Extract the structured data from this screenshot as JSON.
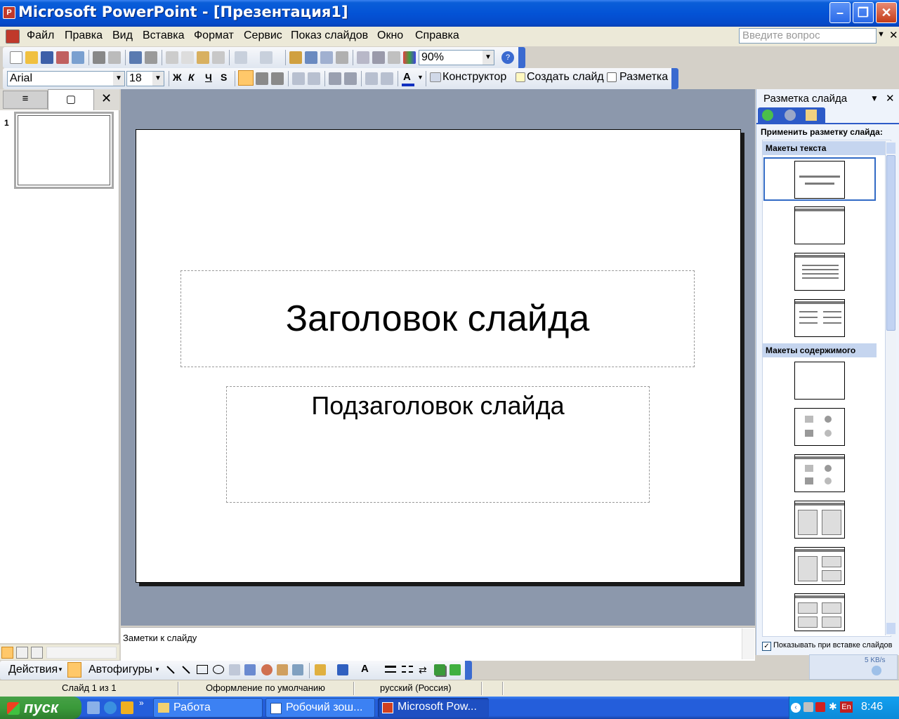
{
  "window": {
    "title": "Microsoft PowerPoint - [Презентация1]"
  },
  "menu": {
    "items": [
      "Файл",
      "Правка",
      "Вид",
      "Вставка",
      "Формат",
      "Сервис",
      "Показ слайдов",
      "Окно",
      "Справка"
    ],
    "ask_placeholder": "Введите вопрос"
  },
  "standard_toolbar": {
    "zoom": "90%"
  },
  "formatting_toolbar": {
    "font": "Arial",
    "size": "18",
    "bold": "Ж",
    "italic": "К",
    "underline": "Ч",
    "shadow": "S",
    "designer": "Конструктор",
    "new_slide": "Создать слайд",
    "layout": "Разметка"
  },
  "slides_pane": {
    "slide_number": "1"
  },
  "slide": {
    "title": "Заголовок слайда",
    "subtitle": "Подзаголовок слайда"
  },
  "notes": {
    "placeholder": "Заметки к слайду"
  },
  "task_pane": {
    "title": "Разметка слайда",
    "apply_label": "Применить разметку слайда:",
    "section_text": "Макеты текста",
    "section_content": "Макеты содержимого",
    "show_on_insert": "Показывать при вставке слайдов"
  },
  "drawing_toolbar": {
    "actions": "Действия",
    "autoshapes": "Автофигуры"
  },
  "status": {
    "slide": "Слайд 1 из 1",
    "design": "Оформление по умолчанию",
    "language": "русский (Россия)"
  },
  "taskbar": {
    "start": "пуск",
    "buttons": [
      "Работа",
      "Робочий зош...",
      "Microsoft Pow..."
    ],
    "clock": "8:46",
    "lang": "En",
    "net_speed": "5 KB/s"
  }
}
